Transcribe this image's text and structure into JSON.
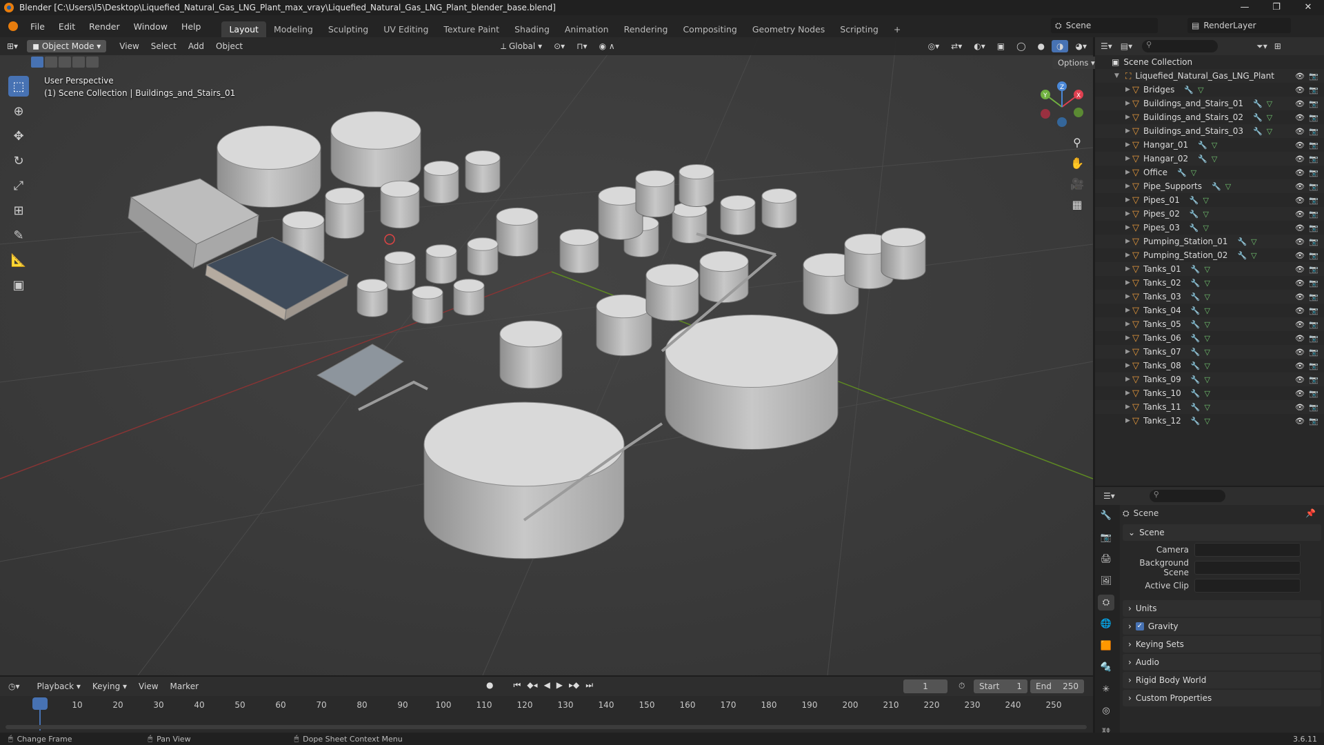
{
  "window": {
    "title": "Blender [C:\\Users\\l5\\Desktop\\Liquefied_Natural_Gas_LNG_Plant_max_vray\\Liquefied_Natural_Gas_LNG_Plant_blender_base.blend]",
    "controls": [
      "—",
      "❐",
      "✕"
    ]
  },
  "menu": {
    "items": [
      "File",
      "Edit",
      "Render",
      "Window",
      "Help"
    ],
    "workspaces": [
      "Layout",
      "Modeling",
      "Sculpting",
      "UV Editing",
      "Texture Paint",
      "Shading",
      "Animation",
      "Rendering",
      "Compositing",
      "Geometry Nodes",
      "Scripting"
    ],
    "active_workspace": "Layout",
    "add_tab": "+",
    "scene": "Scene",
    "render_layer": "RenderLayer"
  },
  "viewport": {
    "mode": "Object Mode",
    "menus": [
      "View",
      "Select",
      "Add",
      "Object"
    ],
    "orientation": "Global",
    "options": "Options",
    "overlay_line1": "User Perspective",
    "overlay_line2": "(1) Scene Collection | Buildings_and_Stairs_01",
    "gizmo": {
      "x": "X",
      "y": "Y",
      "z": "Z"
    }
  },
  "outliner": {
    "root": "Scene Collection",
    "collection": "Liquefied_Natural_Gas_LNG_Plant",
    "items": [
      "Bridges",
      "Buildings_and_Stairs_01",
      "Buildings_and_Stairs_02",
      "Buildings_and_Stairs_03",
      "Hangar_01",
      "Hangar_02",
      "Office",
      "Pipe_Supports",
      "Pipes_01",
      "Pipes_02",
      "Pipes_03",
      "Pumping_Station_01",
      "Pumping_Station_02",
      "Tanks_01",
      "Tanks_02",
      "Tanks_03",
      "Tanks_04",
      "Tanks_05",
      "Tanks_06",
      "Tanks_07",
      "Tanks_08",
      "Tanks_09",
      "Tanks_10",
      "Tanks_11",
      "Tanks_12"
    ]
  },
  "properties": {
    "context": "Scene",
    "panel": "Scene",
    "camera_label": "Camera",
    "background_label": "Background Scene",
    "clip_label": "Active Clip",
    "sections": [
      "Units",
      "Gravity",
      "Keying Sets",
      "Audio",
      "Rigid Body World",
      "Custom Properties"
    ],
    "gravity_checked": true
  },
  "timeline": {
    "menus": [
      "Playback",
      "Keying",
      "View",
      "Marker"
    ],
    "current_frame": "1",
    "start_label": "Start",
    "start": "1",
    "end_label": "End",
    "end": "250",
    "ticks": [
      "1",
      "10",
      "20",
      "30",
      "40",
      "50",
      "60",
      "70",
      "80",
      "90",
      "100",
      "110",
      "120",
      "130",
      "140",
      "150",
      "160",
      "170",
      "180",
      "190",
      "200",
      "210",
      "220",
      "230",
      "240",
      "250"
    ]
  },
  "status": {
    "items": [
      "Change Frame",
      "Pan View",
      "Dope Sheet Context Menu"
    ],
    "version": "3.6.11"
  }
}
